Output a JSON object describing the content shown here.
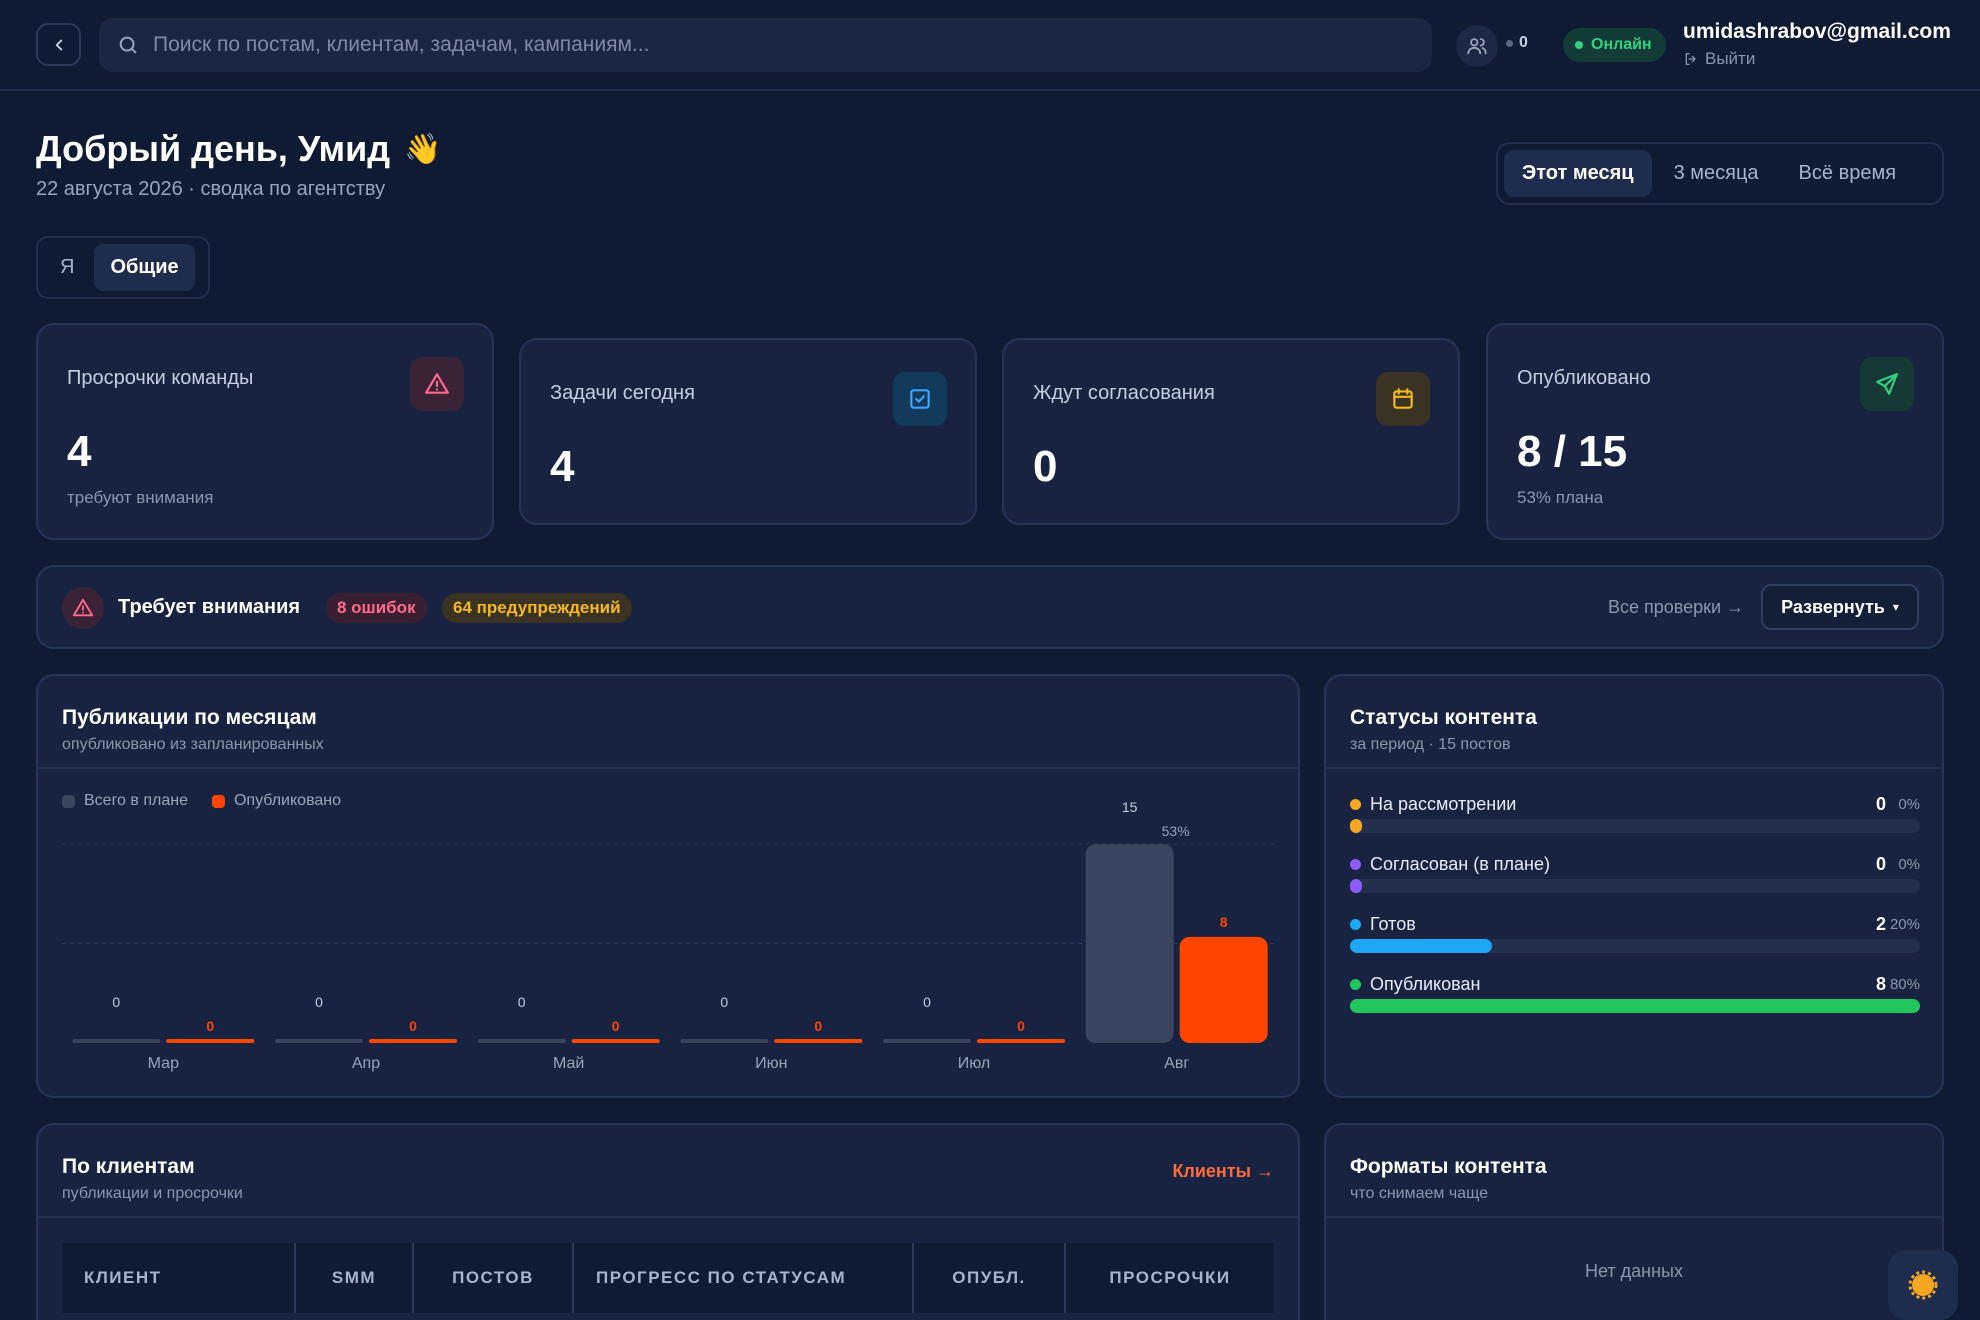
{
  "header": {
    "search_placeholder": "Поиск по постам, клиентам, задачам, кампаниям...",
    "online_users_count": "0",
    "status_label": "Онлайн",
    "user_email": "umidashrabov@gmail.com",
    "logout_label": "Выйти",
    "icons": {
      "back": "chevron-left-icon",
      "search": "search-icon",
      "users": "users-icon",
      "logout": "logout-icon"
    }
  },
  "greeting": {
    "title": "Добрый день, Умид",
    "emoji": "👋",
    "subtitle": "22 августа 2026 · сводка по агентству"
  },
  "period_tabs": {
    "items": [
      "Этот месяц",
      "3 месяца",
      "Всё время"
    ],
    "selected": "Этот месяц"
  },
  "scope_tabs": {
    "items": [
      "Я",
      "Общие"
    ],
    "selected": "Общие"
  },
  "stats": [
    {
      "label": "Просрочки команды",
      "value": "4",
      "note": "требуют внимания",
      "icon": "alert-triangle-icon",
      "color": "#ff6b8b"
    },
    {
      "label": "Задачи сегодня",
      "value": "4",
      "note": "",
      "icon": "check-square-icon",
      "color": "#3da5ff"
    },
    {
      "label": "Ждут согласования",
      "value": "0",
      "note": "",
      "icon": "calendar-icon",
      "color": "#f5b823"
    },
    {
      "label": "Опубликовано",
      "value": "8 / 15",
      "note": "53% плана",
      "icon": "send-icon",
      "color": "#35d07f"
    }
  ],
  "attention": {
    "title": "Требует внимания",
    "errors": "8 ошибок",
    "warnings": "64 предупреждений",
    "all_checks": "Все проверки →",
    "expand": "Развернуть",
    "expand_caret": "▾"
  },
  "publications": {
    "title": "Публикации по месяцам",
    "subtitle": "опубликовано из запланированных",
    "legend_total": "Всего в плане",
    "legend_published": "Опубликовано",
    "chart_data": {
      "type": "bar",
      "categories": [
        "Мар",
        "Апр",
        "Май",
        "Июн",
        "Июл",
        "Авг"
      ],
      "series": [
        {
          "name": "Всего в плане",
          "values": [
            0,
            0,
            0,
            0,
            0,
            15
          ],
          "color": "#39445f"
        },
        {
          "name": "Опубликовано",
          "values": [
            0,
            0,
            0,
            0,
            0,
            8
          ],
          "color": "#ff4500"
        }
      ],
      "annotations": [
        {
          "category": "Авг",
          "text": "53%"
        }
      ],
      "ylim": [
        0,
        15
      ],
      "grid": true,
      "legend": "top-left"
    }
  },
  "statuses": {
    "title": "Статусы контента",
    "subtitle": "за период · 15 постов",
    "items": [
      {
        "label": "На рассмотрении",
        "count": "0",
        "pct": "0%",
        "share": 0,
        "color": "#f5a623"
      },
      {
        "label": "Согласован (в плане)",
        "count": "0",
        "pct": "0%",
        "share": 0,
        "color": "#8b5cf6"
      },
      {
        "label": "Готов",
        "count": "2",
        "pct": "20%",
        "share": 0.25,
        "color": "#1ea7f5"
      },
      {
        "label": "Опубликован",
        "count": "8",
        "pct": "80%",
        "share": 1.0,
        "color": "#22c55e"
      }
    ]
  },
  "clients": {
    "title": "По клиентам",
    "subtitle": "публикации и просрочки",
    "link": "Клиенты →",
    "columns": [
      "КЛИЕНТ",
      "SMM",
      "ПОСТОВ",
      "ПРОГРЕСС ПО СТАТУСАМ",
      "ОПУБЛ.",
      "ПРОСРОЧКИ"
    ]
  },
  "formats": {
    "title": "Форматы контента",
    "subtitle": "что снимаем чаще",
    "empty": "Нет данных"
  }
}
